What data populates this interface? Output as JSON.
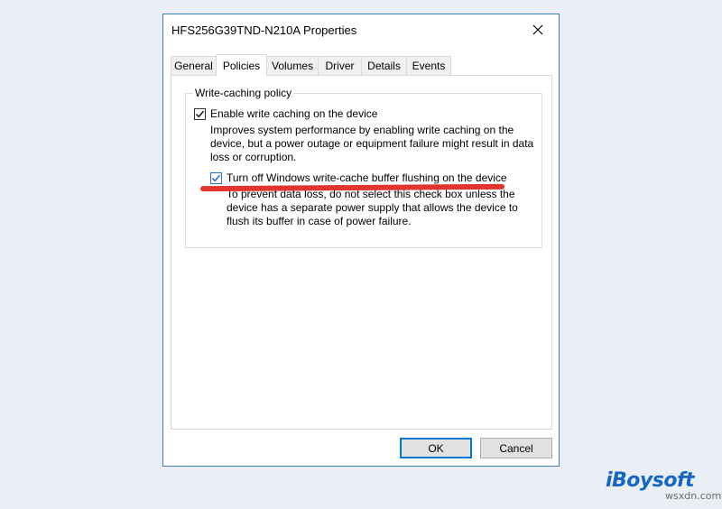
{
  "window": {
    "title": "HFS256G39TND-N210A Properties",
    "close_icon": "close-icon"
  },
  "tabs": [
    {
      "label": "General",
      "active": false
    },
    {
      "label": "Policies",
      "active": true
    },
    {
      "label": "Volumes",
      "active": false
    },
    {
      "label": "Driver",
      "active": false
    },
    {
      "label": "Details",
      "active": false
    },
    {
      "label": "Events",
      "active": false
    }
  ],
  "policies": {
    "group_title": "Write-caching policy",
    "enable_write_caching": {
      "label": "Enable write caching on the device",
      "checked": true,
      "description": [
        "Improves system performance by enabling write caching on the",
        "device, but a power outage or equipment failure might result in data",
        "loss or corruption."
      ]
    },
    "turn_off_flushing": {
      "label": "Turn off Windows write-cache buffer flushing on the device",
      "checked": true,
      "description": [
        "To prevent data loss, do not select this check box unless the",
        "device has a separate power supply that allows the device to",
        "flush its buffer in case of power failure."
      ]
    }
  },
  "buttons": {
    "ok": "OK",
    "cancel": "Cancel"
  },
  "branding": {
    "logo_text": "iBoysoft",
    "watermark": "wsxdn.com"
  },
  "colors": {
    "accent": "#0078d7",
    "window_border": "#3c7fb1",
    "highlight_underline": "#e2352f",
    "brand": "#1667c4"
  }
}
